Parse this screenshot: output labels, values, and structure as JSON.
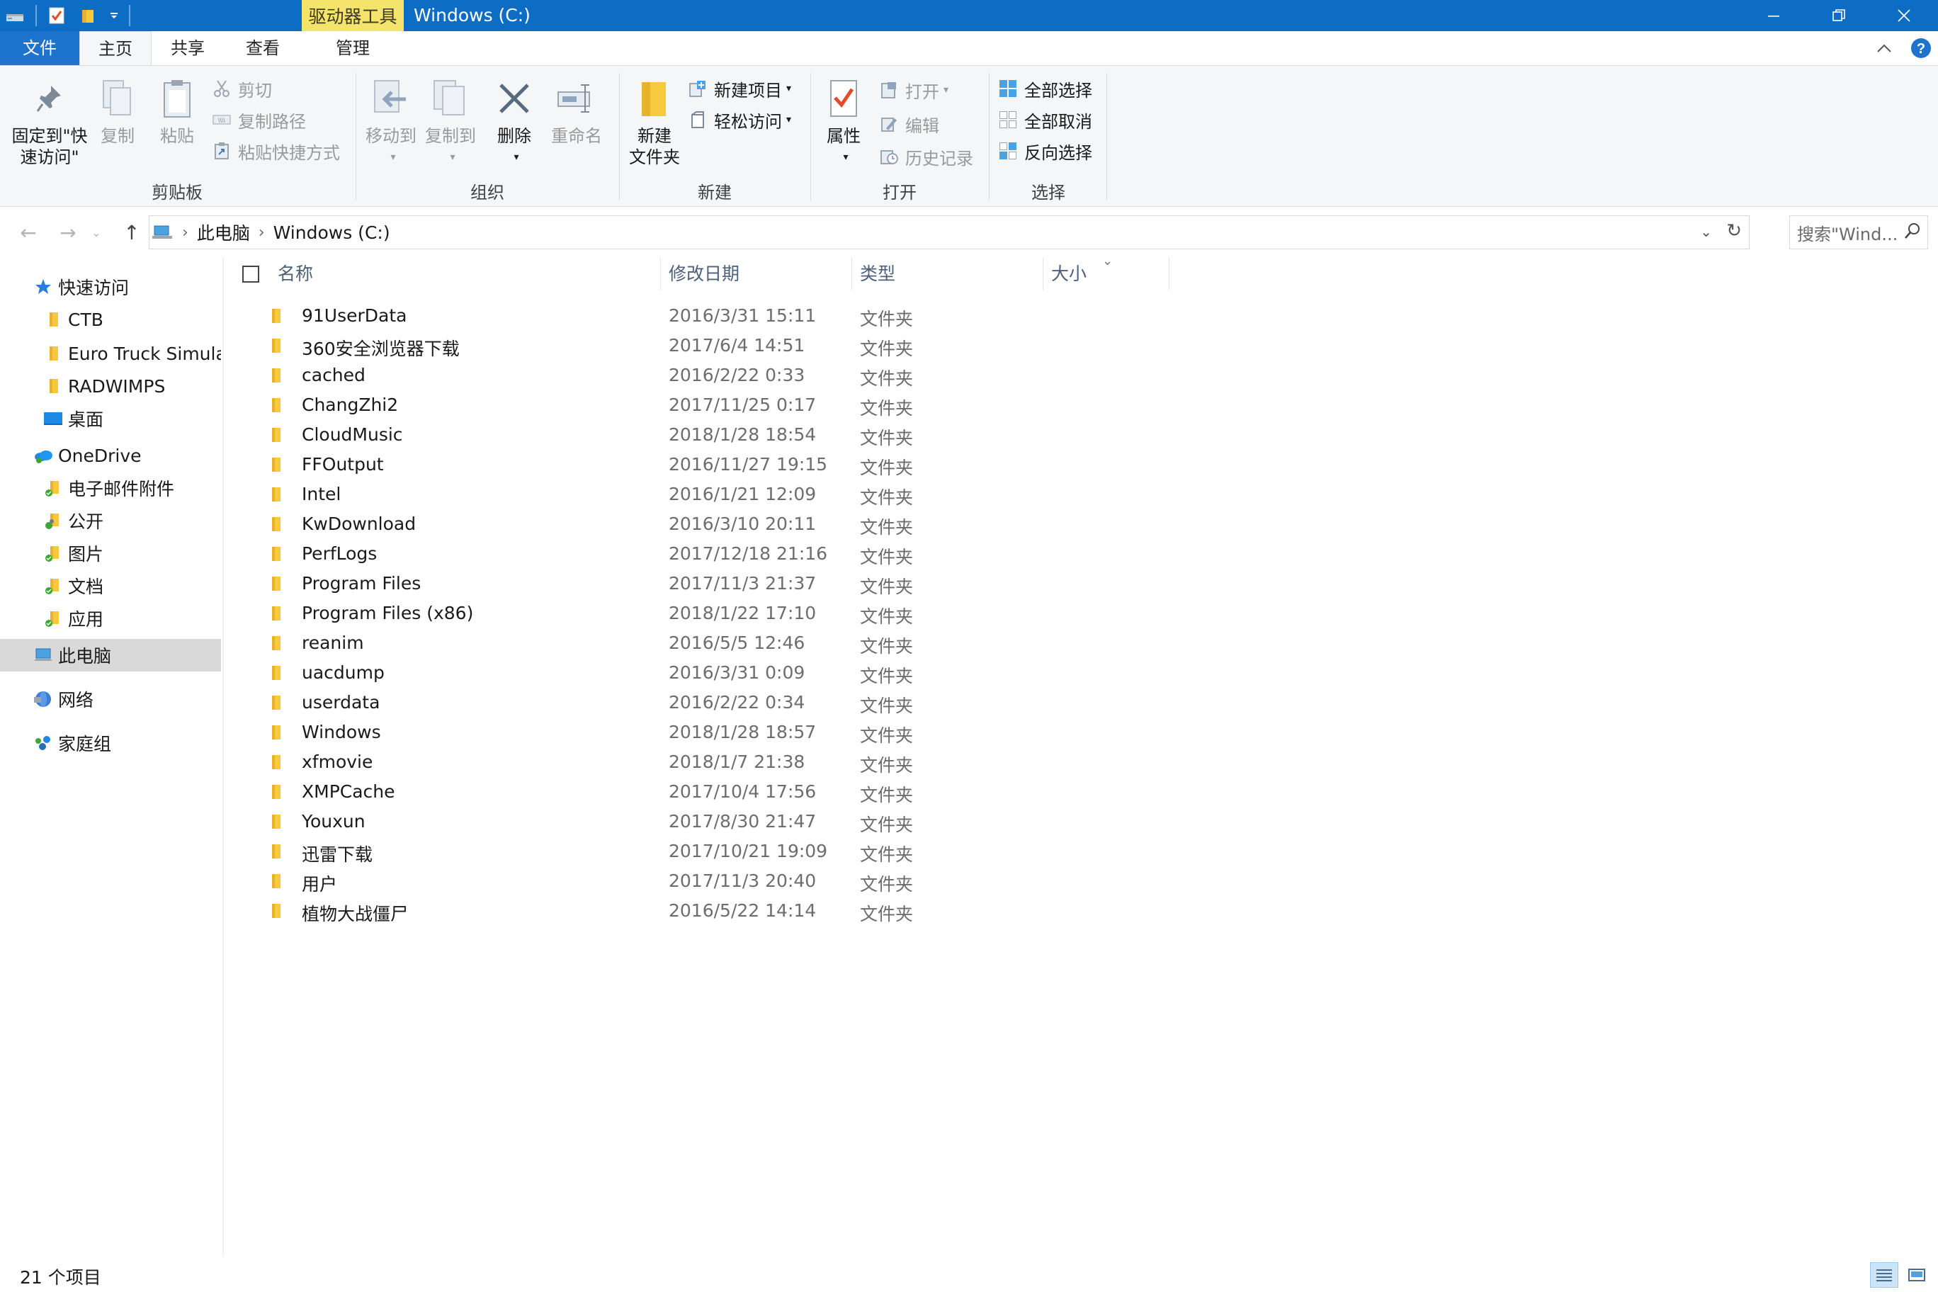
{
  "window": {
    "contextual_tab": "驱动器工具",
    "title": "Windows (C:)",
    "colors": {
      "titlebar": "#0d6dc5",
      "contextual": "#f4e46b",
      "file_tab": "#1e73cc",
      "ribbon_bg": "#f5f6f7",
      "folder": "#f7c93e"
    }
  },
  "tabs": [
    "文件",
    "主页",
    "共享",
    "查看",
    "管理"
  ],
  "ribbon": {
    "clipboard": {
      "label": "剪贴板",
      "pin_line1": "固定到\"快",
      "pin_line2": "速访问\"",
      "copy": "复制",
      "paste": "粘贴",
      "cut": "剪切",
      "copy_path": "复制路径",
      "paste_shortcut": "粘贴快捷方式"
    },
    "organize": {
      "label": "组织",
      "move_to": "移动到",
      "copy_to": "复制到",
      "delete": "删除",
      "rename": "重命名"
    },
    "new": {
      "label": "新建",
      "new_folder_line1": "新建",
      "new_folder_line2": "文件夹",
      "new_item": "新建项目",
      "easy_access": "轻松访问"
    },
    "open": {
      "label": "打开",
      "properties": "属性",
      "open": "打开",
      "edit": "编辑",
      "history": "历史记录"
    },
    "select": {
      "label": "选择",
      "select_all": "全部选择",
      "select_none": "全部取消",
      "invert": "反向选择"
    }
  },
  "address": {
    "crumbs": [
      "此电脑",
      "Windows (C:)"
    ],
    "search_placeholder": "搜索\"Wind..."
  },
  "nav": [
    {
      "label": "快速访问",
      "icon": "star-icon",
      "indent": 0
    },
    {
      "label": "CTB",
      "icon": "folder-icon",
      "indent": 1
    },
    {
      "label": "Euro Truck Simulat",
      "icon": "folder-icon",
      "indent": 1
    },
    {
      "label": "RADWIMPS",
      "icon": "folder-icon",
      "indent": 1
    },
    {
      "label": "桌面",
      "icon": "desktop-icon",
      "indent": 1
    },
    {
      "label": "OneDrive",
      "icon": "cloud-icon",
      "indent": 0
    },
    {
      "label": "电子邮件附件",
      "icon": "synced-folder-icon",
      "indent": 1
    },
    {
      "label": "公开",
      "icon": "shared-folder-icon",
      "indent": 1
    },
    {
      "label": "图片",
      "icon": "synced-folder-icon",
      "indent": 1
    },
    {
      "label": "文档",
      "icon": "synced-folder-icon",
      "indent": 1
    },
    {
      "label": "应用",
      "icon": "synced-folder-icon",
      "indent": 1
    },
    {
      "label": "此电脑",
      "icon": "computer-icon",
      "indent": 0,
      "selected": true
    },
    {
      "label": "网络",
      "icon": "network-icon",
      "indent": 0
    },
    {
      "label": "家庭组",
      "icon": "homegroup-icon",
      "indent": 0
    }
  ],
  "columns": {
    "name": "名称",
    "modified": "修改日期",
    "type": "类型",
    "size": "大小"
  },
  "files": [
    {
      "name": "91UserData",
      "date": "2016/3/31 15:11",
      "type": "文件夹"
    },
    {
      "name": "360安全浏览器下载",
      "date": "2017/6/4 14:51",
      "type": "文件夹"
    },
    {
      "name": "cached",
      "date": "2016/2/22 0:33",
      "type": "文件夹"
    },
    {
      "name": "ChangZhi2",
      "date": "2017/11/25 0:17",
      "type": "文件夹"
    },
    {
      "name": "CloudMusic",
      "date": "2018/1/28 18:54",
      "type": "文件夹"
    },
    {
      "name": "FFOutput",
      "date": "2016/11/27 19:15",
      "type": "文件夹"
    },
    {
      "name": "Intel",
      "date": "2016/1/21 12:09",
      "type": "文件夹"
    },
    {
      "name": "KwDownload",
      "date": "2016/3/10 20:11",
      "type": "文件夹"
    },
    {
      "name": "PerfLogs",
      "date": "2017/12/18 21:16",
      "type": "文件夹"
    },
    {
      "name": "Program Files",
      "date": "2017/11/3 21:37",
      "type": "文件夹"
    },
    {
      "name": "Program Files (x86)",
      "date": "2018/1/22 17:10",
      "type": "文件夹"
    },
    {
      "name": "reanim",
      "date": "2016/5/5 12:46",
      "type": "文件夹"
    },
    {
      "name": "uacdump",
      "date": "2016/3/31 0:09",
      "type": "文件夹"
    },
    {
      "name": "userdata",
      "date": "2016/2/22 0:34",
      "type": "文件夹"
    },
    {
      "name": "Windows",
      "date": "2018/1/28 18:57",
      "type": "文件夹"
    },
    {
      "name": "xfmovie",
      "date": "2018/1/7 21:38",
      "type": "文件夹"
    },
    {
      "name": "XMPCache",
      "date": "2017/10/4 17:56",
      "type": "文件夹"
    },
    {
      "name": "Youxun",
      "date": "2017/8/30 21:47",
      "type": "文件夹"
    },
    {
      "name": "迅雷下载",
      "date": "2017/10/21 19:09",
      "type": "文件夹"
    },
    {
      "name": "用户",
      "date": "2017/11/3 20:40",
      "type": "文件夹"
    },
    {
      "name": "植物大战僵尸",
      "date": "2016/5/22 14:14",
      "type": "文件夹"
    }
  ],
  "status": {
    "count": "21 个项目"
  }
}
